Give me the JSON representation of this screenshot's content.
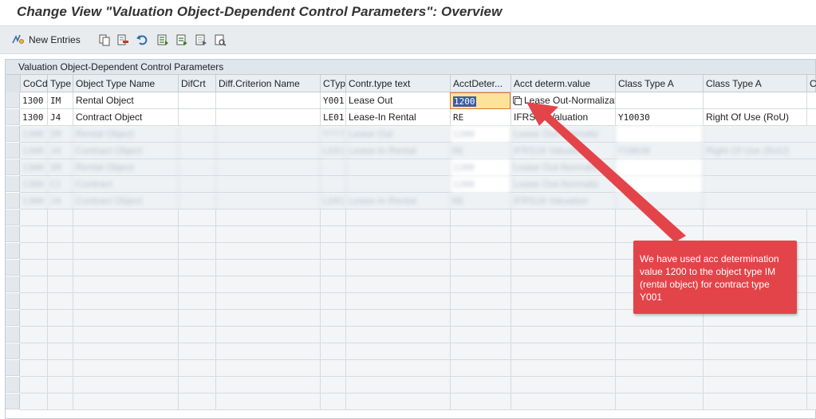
{
  "title": "Change View \"Valuation Object-Dependent Control Parameters\": Overview",
  "toolbar": {
    "new_entries_label": "New Entries",
    "icons": [
      "display-change-icon",
      "copy-icon",
      "delete-icon",
      "undo-icon",
      "select-all-icon",
      "select-block-icon",
      "deselect-all-icon",
      "print-icon"
    ]
  },
  "panel": {
    "title": "Valuation Object-Dependent Control Parameters"
  },
  "columns": [
    "CoCd",
    "Type",
    "Object Type Name",
    "DifCrt",
    "Diff.Criterion Name",
    "CTyp",
    "Contr.type text",
    "AcctDeter...",
    "Acct determ.value",
    "Class Type A",
    "Class Type A",
    "Cl"
  ],
  "rows": [
    {
      "cocd": "1300",
      "type": "IM",
      "obj_name": "Rental Object",
      "difcrt": "",
      "diff_name": "",
      "ctyp": "Y001",
      "ctext": "Lease Out",
      "acct": "1200",
      "acct_value": "Lease Out-Normalizatio..",
      "class_a": "",
      "class_a_text": ""
    },
    {
      "cocd": "1300",
      "type": "J4",
      "obj_name": "Contract Object",
      "difcrt": "",
      "diff_name": "",
      "ctyp": "LE01",
      "ctext": "Lease-In Rental",
      "acct": "RE",
      "acct_value": "IFRS16 Valuation",
      "class_a": "Y10030",
      "class_a_text": "Right Of Use (RoU)"
    }
  ],
  "blurred_rows": [
    {
      "cocd": "1300",
      "type": "IM",
      "obj_name": "Rental Object",
      "ctyp": "Y???",
      "ctext": "Lease Out",
      "acct": "1200",
      "acct_value": "Lease Out-Normaliz"
    },
    {
      "cocd": "1300",
      "type": "J4",
      "obj_name": "Contract Object",
      "ctyp": "LE01",
      "ctext": "Lease-In Rental",
      "acct": "RE",
      "acct_value": "IFRS16 Valuation",
      "class_a": "Y10030",
      "class_a_text": "Right Of Use (RoU)"
    },
    {
      "cocd": "1300",
      "type": "IM",
      "obj_name": "Rental Object",
      "ctyp": "",
      "ctext": "",
      "acct": "1200",
      "acct_value": "Lease Out-Normaliz"
    },
    {
      "cocd": "1300",
      "type": "CI",
      "obj_name": "Contract",
      "ctyp": "",
      "ctext": "",
      "acct": "1200",
      "acct_value": "Lease Out-Normaliz"
    },
    {
      "cocd": "1300",
      "type": "J4",
      "obj_name": "Contract Object",
      "ctyp": "LE01",
      "ctext": "Lease-In Rental",
      "acct": "RE",
      "acct_value": "IFRS16 Valuation"
    }
  ],
  "annotation": {
    "text": "We have used acc determination value 1200 to the object type IM (rental object) for contract type Y001"
  },
  "colors": {
    "annotation_bg": "#e3444a",
    "input_highlight": "#fbe49a",
    "selection": "#3d5e9a"
  }
}
